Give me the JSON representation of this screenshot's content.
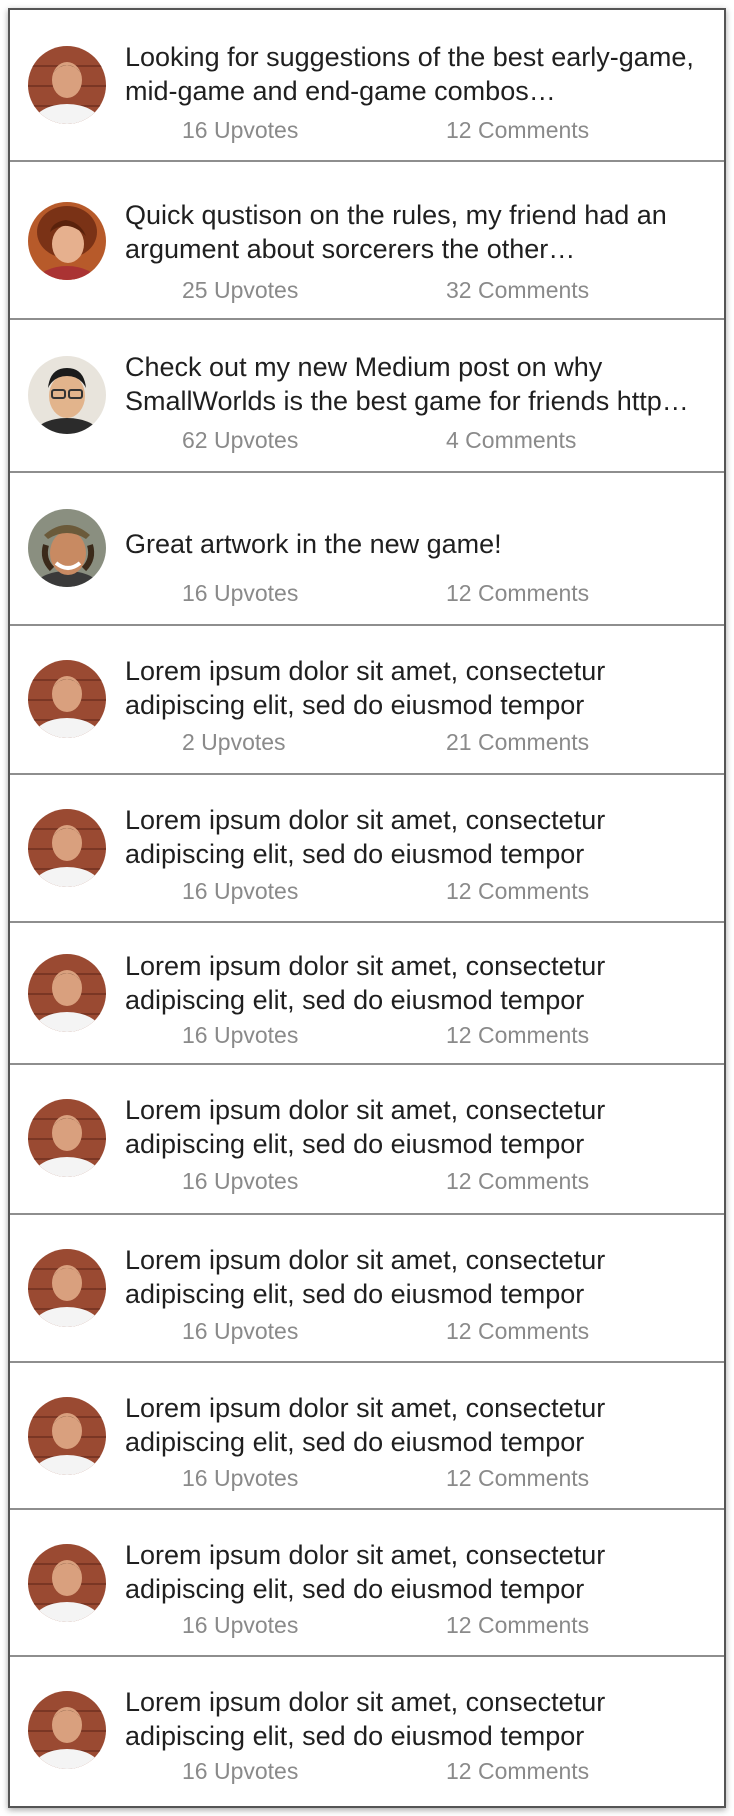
{
  "colors": {
    "post_text": "#1f1f1f",
    "stat_text": "#8a8a8a",
    "divider": "#8e8e8e"
  },
  "posts": [
    {
      "avatar": "man-brick-wall",
      "text": "Looking for suggestions of the best early-game, mid-game and end-game combos…",
      "upvotes": "16 Upvotes",
      "comments": "12 Comments"
    },
    {
      "avatar": "woman-curly-hair",
      "text": "Quick qustison on the rules, my friend had an argument about sorcerers the other…",
      "upvotes": "25 Upvotes",
      "comments": "32 Comments"
    },
    {
      "avatar": "man-glasses",
      "text": "Check out my new Medium post on why SmallWorlds is the best game for friends http…",
      "upvotes": "62 Upvotes",
      "comments": "4 Comments"
    },
    {
      "avatar": "man-hat-smiling",
      "text": "Great artwork in the new game!",
      "upvotes": "16 Upvotes",
      "comments": "12 Comments"
    },
    {
      "avatar": "man-brick-wall",
      "text": "Lorem ipsum dolor sit amet, consectetur adipiscing elit, sed do eiusmod tempor",
      "upvotes": "2 Upvotes",
      "comments": "21 Comments"
    },
    {
      "avatar": "man-brick-wall",
      "text": "Lorem ipsum dolor sit amet, consectetur adipiscing elit, sed do eiusmod tempor",
      "upvotes": "16 Upvotes",
      "comments": "12 Comments"
    },
    {
      "avatar": "man-brick-wall",
      "text": "Lorem ipsum dolor sit amet, consectetur adipiscing elit, sed do eiusmod tempor",
      "upvotes": "16 Upvotes",
      "comments": "12 Comments"
    },
    {
      "avatar": "man-brick-wall",
      "text": "Lorem ipsum dolor sit amet, consectetur adipiscing elit, sed do eiusmod tempor",
      "upvotes": "16 Upvotes",
      "comments": "12 Comments"
    },
    {
      "avatar": "man-brick-wall",
      "text": "Lorem ipsum dolor sit amet, consectetur adipiscing elit, sed do eiusmod tempor",
      "upvotes": "16 Upvotes",
      "comments": "12 Comments"
    },
    {
      "avatar": "man-brick-wall",
      "text": "Lorem ipsum dolor sit amet, consectetur adipiscing elit, sed do eiusmod tempor",
      "upvotes": "16 Upvotes",
      "comments": "12 Comments"
    },
    {
      "avatar": "man-brick-wall",
      "text": "Lorem ipsum dolor sit amet, consectetur adipiscing elit, sed do eiusmod tempor",
      "upvotes": "16 Upvotes",
      "comments": "12 Comments"
    },
    {
      "avatar": "man-brick-wall",
      "text": "Lorem ipsum dolor sit amet, consectetur adipiscing elit, sed do eiusmod tempor",
      "upvotes": "16 Upvotes",
      "comments": "12 Comments"
    }
  ]
}
